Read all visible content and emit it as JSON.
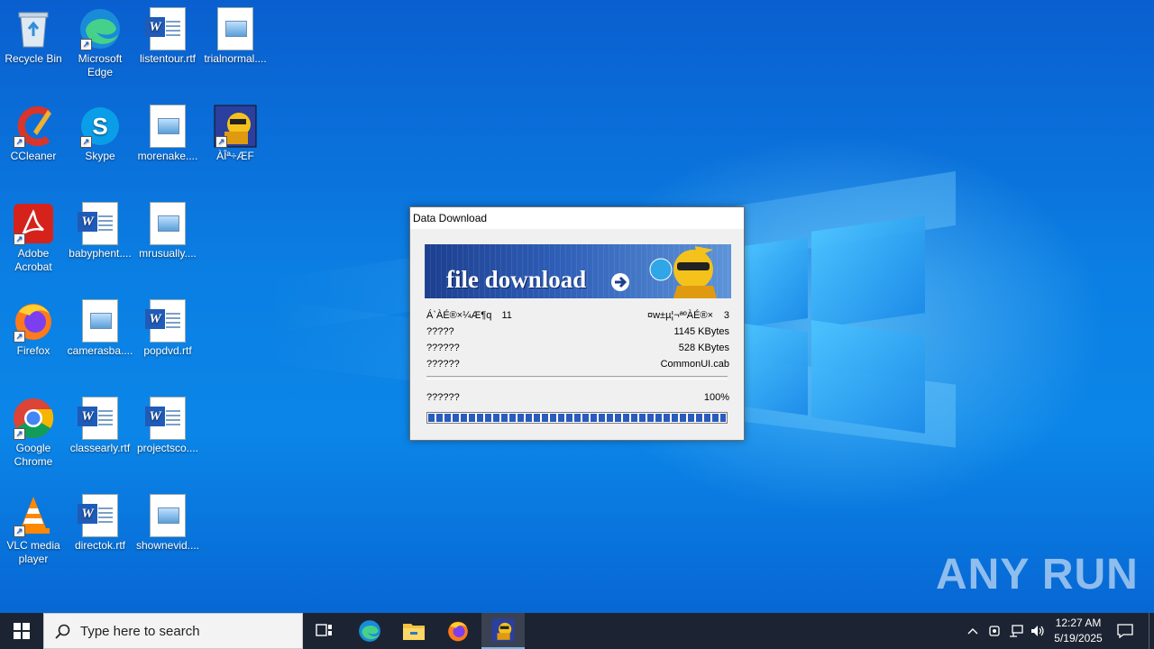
{
  "desktop_icons": [
    {
      "label": "Recycle Bin",
      "icon": "recycle-bin-icon"
    },
    {
      "label": "Microsoft Edge",
      "icon": "edge-icon"
    },
    {
      "label": "listentour.rtf",
      "icon": "word-doc-icon"
    },
    {
      "label": "trialnormal....",
      "icon": "image-file-icon"
    },
    {
      "label": "CCleaner",
      "icon": "ccleaner-icon"
    },
    {
      "label": "Skype",
      "icon": "skype-icon"
    },
    {
      "label": "morenake....",
      "icon": "image-file-icon"
    },
    {
      "label": "ÀÎª÷ÆF",
      "icon": "setup-app-icon"
    },
    {
      "label": "Adobe Acrobat",
      "icon": "acrobat-icon"
    },
    {
      "label": "babyphent....",
      "icon": "word-doc-icon"
    },
    {
      "label": "mrusually....",
      "icon": "image-file-icon"
    },
    {
      "label": "Firefox",
      "icon": "firefox-icon"
    },
    {
      "label": "camerasba....",
      "icon": "image-file-icon"
    },
    {
      "label": "popdvd.rtf",
      "icon": "word-doc-icon"
    },
    {
      "label": "Google Chrome",
      "icon": "chrome-icon"
    },
    {
      "label": "classearly.rtf",
      "icon": "word-doc-icon"
    },
    {
      "label": "projectsco....",
      "icon": "word-doc-icon"
    },
    {
      "label": "VLC media player",
      "icon": "vlc-icon"
    },
    {
      "label": "directok.rtf",
      "icon": "word-doc-icon"
    },
    {
      "label": "shownevid....",
      "icon": "image-file-icon"
    }
  ],
  "dialog": {
    "title": "Data Download",
    "banner_text": "file download",
    "row1_left": "Á`ÀÉ®×¼Æ¶q",
    "row1_count": "11",
    "row1_right_label": "¤w±µ¦¬ªºÀÉ®×",
    "row1_right_count": "3",
    "row2_label": "?????",
    "row2_value": "1145 KBytes",
    "row3_label": "??????",
    "row3_value": "528 KBytes",
    "row4_label": "??????",
    "row4_value": "CommonUI.cab",
    "row5_label": "??????",
    "row5_value": "100%",
    "progress": 1.0
  },
  "taskbar": {
    "search_placeholder": "Type here to search",
    "apps": [
      "task-view-icon",
      "edge-icon",
      "file-explorer-icon",
      "firefox-icon",
      "setup-app-icon"
    ],
    "time": "12:27 AM",
    "date": "5/19/2025"
  },
  "watermark": "ANY RUN",
  "colors": {
    "taskbar": "#1c2433",
    "desktop": "#0b7fe3",
    "progress": "#2a5bbd"
  }
}
